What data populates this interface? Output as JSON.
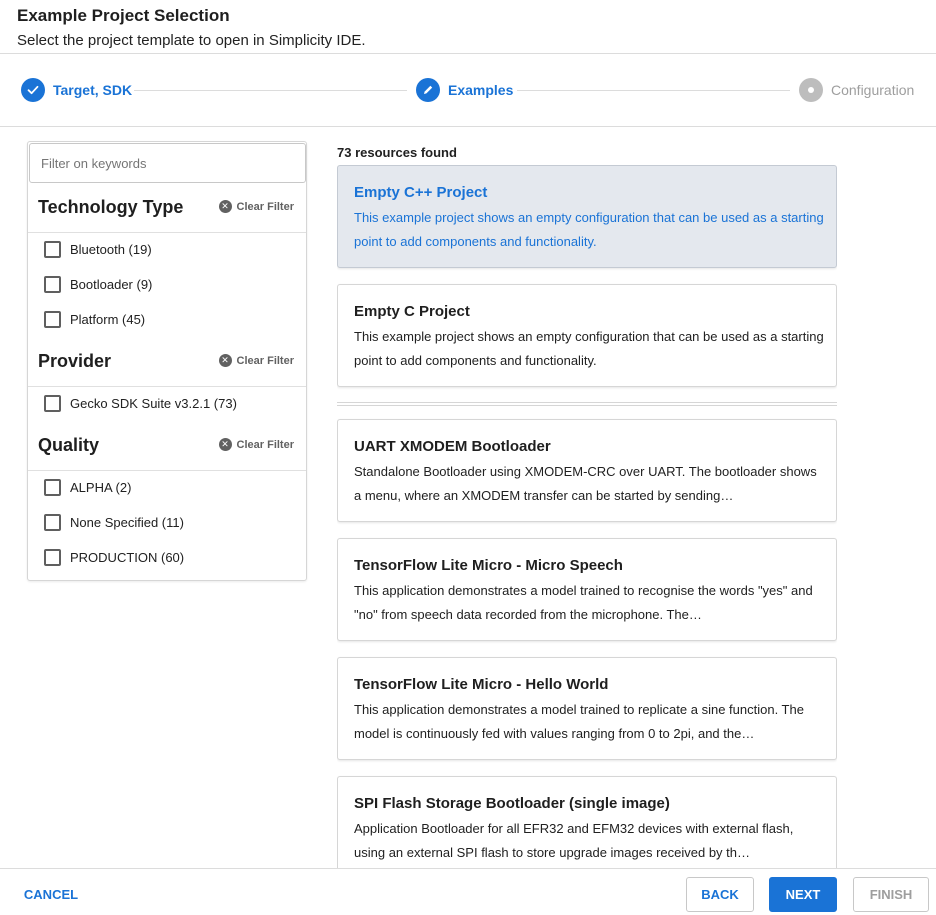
{
  "header": {
    "title": "Example Project Selection",
    "subtitle": "Select the project template to open in Simplicity IDE."
  },
  "stepper": {
    "steps": [
      {
        "label": "Target, SDK",
        "state": "done",
        "icon": "check-icon"
      },
      {
        "label": "Examples",
        "state": "active",
        "icon": "pencil-icon"
      },
      {
        "label": "Configuration",
        "state": "pending",
        "icon": "dot-icon"
      }
    ]
  },
  "filters": {
    "search_placeholder": "Filter on keywords",
    "clear_label": "Clear Filter",
    "groups": [
      {
        "title": "Technology Type",
        "options": [
          {
            "label": "Bluetooth (19)",
            "checked": false
          },
          {
            "label": "Bootloader (9)",
            "checked": false
          },
          {
            "label": "Platform (45)",
            "checked": false
          }
        ]
      },
      {
        "title": "Provider",
        "options": [
          {
            "label": "Gecko SDK Suite v3.2.1 (73)",
            "checked": false
          }
        ]
      },
      {
        "title": "Quality",
        "options": [
          {
            "label": "ALPHA (2)",
            "checked": false
          },
          {
            "label": "None Specified (11)",
            "checked": false
          },
          {
            "label": "PRODUCTION (60)",
            "checked": false
          }
        ]
      }
    ]
  },
  "results": {
    "count_label": "73 resources found",
    "items": [
      {
        "title": "Empty C++ Project",
        "description": "This example project shows an empty configuration that can be used as a starting point to add components and functionality.",
        "selected": true
      },
      {
        "title": "Empty C Project",
        "description": "This example project shows an empty configuration that can be used as a starting point to add components and functionality.",
        "selected": false
      },
      {
        "title": "UART XMODEM Bootloader",
        "description": "Standalone Bootloader using XMODEM-CRC over UART. The bootloader shows a menu, where an XMODEM transfer can be started by sending…",
        "selected": false
      },
      {
        "title": "TensorFlow Lite Micro - Micro Speech",
        "description": "This application demonstrates a model trained to recognise the words \"yes\" and \"no\" from speech data recorded from the microphone. The…",
        "selected": false
      },
      {
        "title": "TensorFlow Lite Micro - Hello World",
        "description": "This application demonstrates a model trained to replicate a sine function. The model is continuously fed with values ranging from 0 to 2pi, and the…",
        "selected": false
      },
      {
        "title": "SPI Flash Storage Bootloader (single image)",
        "description": "Application Bootloader for all EFR32 and EFM32 devices with external flash, using an external SPI flash to store upgrade images received by th…",
        "selected": false
      }
    ]
  },
  "footer": {
    "cancel_label": "CANCEL",
    "back_label": "BACK",
    "next_label": "NEXT",
    "finish_label": "FINISH"
  },
  "colors": {
    "accent": "#1a73d6",
    "selected_card_bg": "#e4e8ee",
    "disabled_text": "#9e9e9e"
  }
}
